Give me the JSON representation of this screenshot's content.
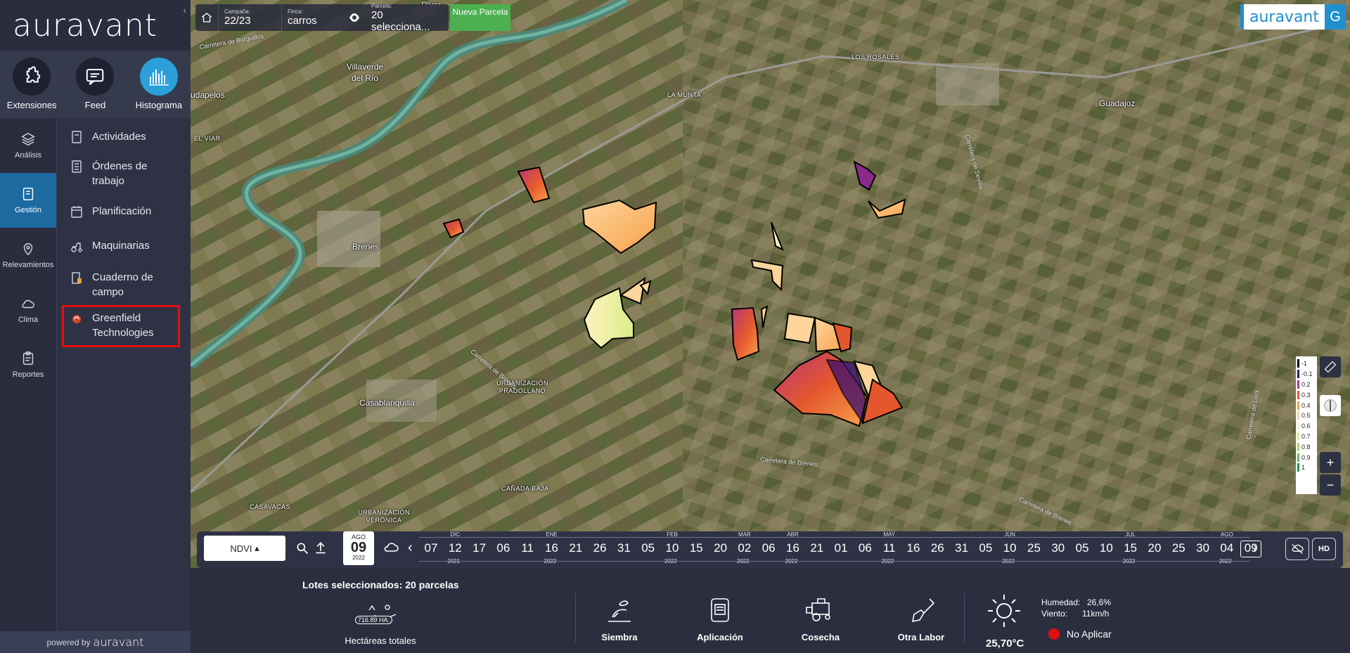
{
  "brand": {
    "logo_text": "auravant",
    "box_text": "auravant",
    "user_initial": "G",
    "powered_prefix": "powered by",
    "powered_brand": "auravant"
  },
  "tools": [
    {
      "label": "Extensiones",
      "icon": "puzzle-icon"
    },
    {
      "label": "Feed",
      "icon": "chat-icon"
    },
    {
      "label": "Histograma",
      "icon": "histogram-icon"
    }
  ],
  "nav": [
    {
      "label": "Análisis",
      "icon": "layers-icon"
    },
    {
      "label": "Gestión",
      "icon": "clipboard-icon"
    },
    {
      "label": "Relevamientos",
      "icon": "pin-icon"
    },
    {
      "label": "Clima",
      "icon": "cloud-icon"
    },
    {
      "label": "Reportes",
      "icon": "report-icon"
    }
  ],
  "submenu": [
    {
      "label": "Actividades"
    },
    {
      "label": "Órdenes de trabajo"
    },
    {
      "label": "Planificación"
    },
    {
      "label": "Maquinarias"
    },
    {
      "label": "Cuaderno de campo"
    },
    {
      "label": "Greenfield Technologies"
    }
  ],
  "filters": {
    "campaign_label": "Campaña:",
    "campaign_value": "22/23",
    "farm_label": "Finca:",
    "farm_value": "carros",
    "parcel_label": "Parcela:",
    "parcel_value": "20 selecciona...",
    "new_parcel": "Nueva Parcela"
  },
  "map_labels": {
    "river": "River",
    "villaverde": "Villaverde del Río",
    "budapelos": "udapelos",
    "elviar": "EL VIAR",
    "brenes": "Brenes",
    "casablanquilla": "Casablanquilla",
    "casavacas": "CASAVACAS",
    "urb_veronica": "URBANIZACIÓN VERÓNICA",
    "canada_baja": "CAÑADA BAJA",
    "urb_pradollano": "URBANIZACIÓN PRADOLLANO",
    "la_munta": "LA MUNTA",
    "los_rosales": "LOS ROSALES",
    "guadajoz": "Guadajoz",
    "road_burguillos": "Carretera de Burguillos",
    "road_sevilla": "Carretera de Sevilla",
    "road_brenes1": "Carretera de Brenes",
    "road_brenes2": "Carretera de Brenes",
    "road_brenes3": "Carretera de Brenes",
    "road_lora": "Carretera de Lora"
  },
  "legend": [
    {
      "value": "-1",
      "color": "#000000"
    },
    {
      "value": "-0.1",
      "color": "#3b0f70"
    },
    {
      "value": "0.2",
      "color": "#b5367a"
    },
    {
      "value": "0.3",
      "color": "#e4572e"
    },
    {
      "value": "0.4",
      "color": "#f8a14b"
    },
    {
      "value": "0.5",
      "color": "#fdd59b"
    },
    {
      "value": "0.6",
      "color": "#fff0c0"
    },
    {
      "value": "0.7",
      "color": "#d9ef8b"
    },
    {
      "value": "0.8",
      "color": "#a6d96a"
    },
    {
      "value": "0.9",
      "color": "#66bd63"
    },
    {
      "value": "1",
      "color": "#1a9850"
    }
  ],
  "map_controls": {
    "zoom_in": "+",
    "zoom_out": "−"
  },
  "timeline": {
    "index": "NDVI",
    "date_month": "AGO",
    "date_day": "09",
    "date_year": "2022",
    "days": [
      "07",
      "12",
      "17",
      "06",
      "11",
      "16",
      "21",
      "26",
      "31",
      "05",
      "10",
      "15",
      "20",
      "02",
      "06",
      "16",
      "21",
      "01",
      "06",
      "11",
      "16",
      "26",
      "31",
      "05",
      "10",
      "25",
      "30",
      "05",
      "10",
      "15",
      "20",
      "25",
      "30",
      "04",
      "09"
    ],
    "months": [
      {
        "label": "DIC",
        "at": 1
      },
      {
        "label": "ENE",
        "at": 5
      },
      {
        "label": "FEB",
        "at": 10
      },
      {
        "label": "MAR",
        "at": 13
      },
      {
        "label": "ABR",
        "at": 15
      },
      {
        "label": "MAY",
        "at": 19
      },
      {
        "label": "JUN",
        "at": 24
      },
      {
        "label": "JUL",
        "at": 29
      },
      {
        "label": "AGO",
        "at": 33
      }
    ],
    "years": [
      {
        "label": "2021",
        "at": 1
      },
      {
        "label": "2022",
        "at": 5
      },
      {
        "label": "2022",
        "at": 10
      },
      {
        "label": "2022",
        "at": 13
      },
      {
        "label": "2022",
        "at": 15
      },
      {
        "label": "2022",
        "at": 19
      },
      {
        "label": "2022",
        "at": 24
      },
      {
        "label": "2022",
        "at": 29
      },
      {
        "label": "2022",
        "at": 33
      }
    ],
    "hd": "HD"
  },
  "bottom": {
    "selected": "Lotes seleccionados: 20 parcelas",
    "hectares": "716.89 HA.",
    "hectares_label": "Hectáreas totales",
    "actions": [
      {
        "label": "Siembra",
        "icon": "seeding-icon"
      },
      {
        "label": "Aplicación",
        "icon": "application-icon"
      },
      {
        "label": "Cosecha",
        "icon": "harvester-icon"
      },
      {
        "label": "Otra Labor",
        "icon": "shovel-icon"
      }
    ],
    "humidity_label": "Humedad:",
    "humidity_value": "26,6%",
    "wind_label": "Viento:",
    "wind_value": "11km/h",
    "temperature": "25,70°C",
    "spray_status": "No Aplicar"
  }
}
